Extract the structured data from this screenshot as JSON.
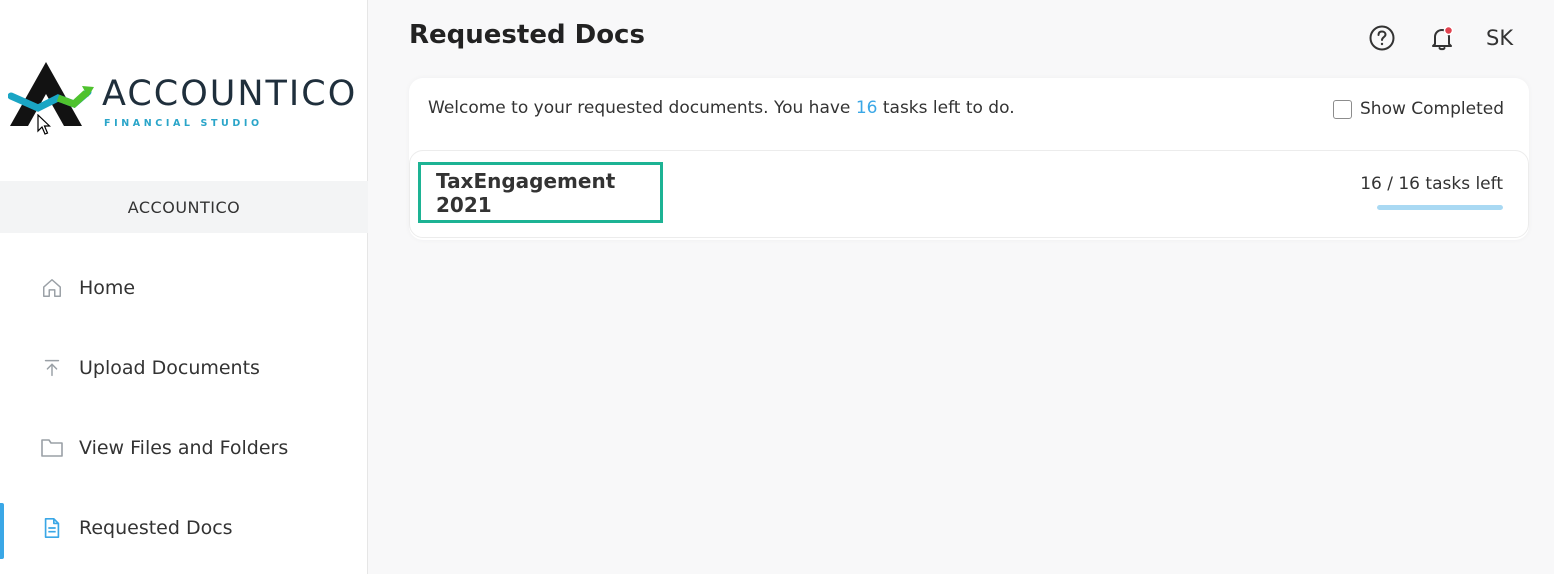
{
  "brand": {
    "name": "ACCOUNTICO",
    "tagline": "FINANCIAL STUDIO",
    "org_name": "ACCOUNTICO"
  },
  "sidebar": {
    "items": [
      {
        "label": "Home",
        "icon": "home-icon",
        "active": false
      },
      {
        "label": "Upload Documents",
        "icon": "upload-icon",
        "active": false
      },
      {
        "label": "View Files and Folders",
        "icon": "folder-icon",
        "active": false
      },
      {
        "label": "Requested Docs",
        "icon": "document-icon",
        "active": true
      }
    ]
  },
  "header": {
    "title": "Requested Docs",
    "help_icon": "help-circle-icon",
    "bell_icon": "bell-icon",
    "user_initials": "SK"
  },
  "main": {
    "welcome_prefix": "Welcome to your requested documents. You have ",
    "tasks_count": "16",
    "welcome_suffix": " tasks left to do.",
    "show_completed_label": "Show Completed",
    "show_completed_checked": false,
    "engagements": [
      {
        "title": "TaxEngagement 2021",
        "progress_text": "16 / 16 tasks left",
        "progress_fraction": 1.0
      }
    ]
  },
  "colors": {
    "accent": "#3aa7e6",
    "highlight_border": "#1db394",
    "notification_dot": "#e0424f"
  }
}
